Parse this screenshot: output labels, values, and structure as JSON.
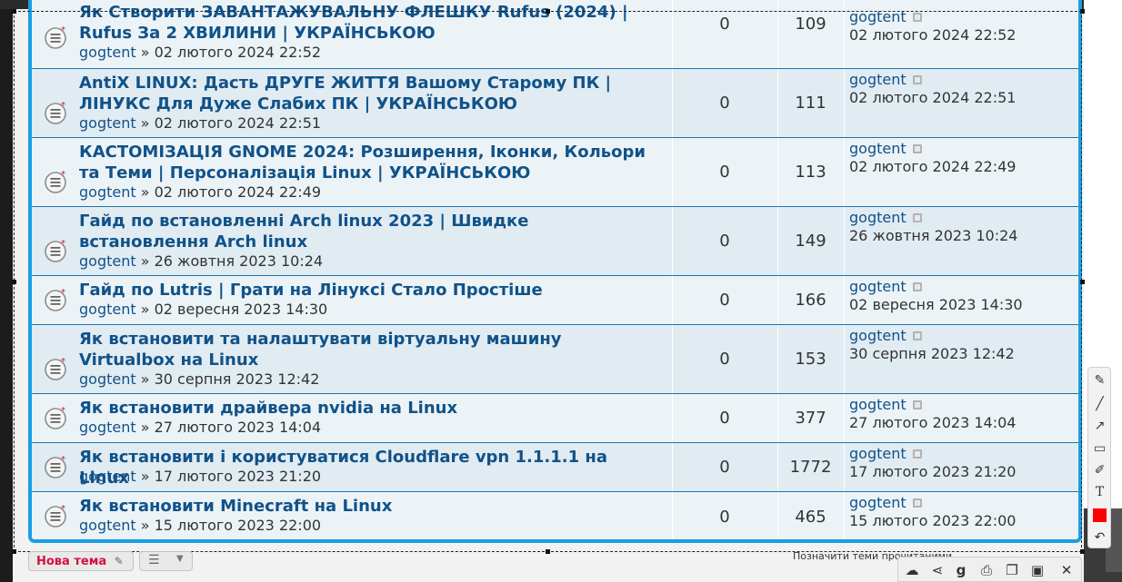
{
  "topics": [
    {
      "title": "Як Створити ЗАВАНТАЖУВАЛЬНУ ФЛЕШКУ Rufus (2024) | Rufus За 2 ХВИЛИНИ | УКРАЇНСЬКОЮ",
      "author": "gogtent",
      "sep": " » ",
      "date": "02 лютого 2024 22:52",
      "replies": "0",
      "views": "109",
      "last_author": "gogtent",
      "last_date": "02 лютого 2024 22:52"
    },
    {
      "title": "AntiX LINUX: Дасть ДРУГЕ ЖИТТЯ Вашому Старому ПК | ЛІНУКС Для Дуже Слабих ПК | УКРАЇНСЬКОЮ",
      "author": "gogtent",
      "sep": " » ",
      "date": "02 лютого 2024 22:51",
      "replies": "0",
      "views": "111",
      "last_author": "gogtent",
      "last_date": "02 лютого 2024 22:51"
    },
    {
      "title": "КАСТОМІЗАЦІЯ GNOME 2024: Розширення, Іконки, Кольори та Теми | Персоналізація Linux | УКРАЇНСЬКОЮ",
      "author": "gogtent",
      "sep": " » ",
      "date": "02 лютого 2024 22:49",
      "replies": "0",
      "views": "113",
      "last_author": "gogtent",
      "last_date": "02 лютого 2024 22:49"
    },
    {
      "title": "Гайд по встановленні Arch linux 2023 | Швидке встановлення Arch linux",
      "author": "gogtent",
      "sep": " » ",
      "date": "26 жовтня 2023 10:24",
      "replies": "0",
      "views": "149",
      "last_author": "gogtent",
      "last_date": "26 жовтня 2023 10:24"
    },
    {
      "title": "Гайд по Lutris | Грати на Лінуксі Стало Простіше",
      "author": "gogtent",
      "sep": " » ",
      "date": "02 вересня 2023 14:30",
      "replies": "0",
      "views": "166",
      "last_author": "gogtent",
      "last_date": "02 вересня 2023 14:30"
    },
    {
      "title": "Як встановити та налаштувати віртуальну машину Virtualbox на Linux",
      "author": "gogtent",
      "sep": " » ",
      "date": "30 серпня 2023 12:42",
      "replies": "0",
      "views": "153",
      "last_author": "gogtent",
      "last_date": "30 серпня 2023 12:42"
    },
    {
      "title": "Як встановити драйвера nvidia на Linux",
      "author": "gogtent",
      "sep": " » ",
      "date": "27 лютого 2023 14:04",
      "replies": "0",
      "views": "377",
      "last_author": "gogtent",
      "last_date": "27 лютого 2023 14:04"
    },
    {
      "title": "Як встановити і користуватися Cloudflare vpn 1.1.1.1 на Linux",
      "author": "gogtent",
      "sep": " » ",
      "date": "17 лютого 2023 21:20",
      "replies": "0",
      "views": "1772",
      "last_author": "gogtent",
      "last_date": "17 лютого 2023 21:20"
    },
    {
      "title": "Як встановити Minecraft на Linux",
      "author": "gogtent",
      "sep": " » ",
      "date": "15 лютого 2023 22:00",
      "replies": "0",
      "views": "465",
      "last_author": "gogtent",
      "last_date": "15 лютого 2023 22:00"
    }
  ],
  "actions": {
    "new_topic": "Нова тема",
    "mark_read": "Позначити теми прочитаними"
  },
  "palette_tools": [
    "pencil-icon",
    "line-icon",
    "arrow-icon",
    "rectangle-icon",
    "marker-icon",
    "text-icon",
    "color-icon",
    "undo-icon"
  ],
  "toolbar_tools": [
    "upload-icon",
    "share-icon",
    "search-google-icon",
    "print-icon",
    "copy-icon",
    "save-icon",
    "close-icon"
  ],
  "colors": {
    "accent": "#1a9ee4",
    "link": "#105289",
    "selected_color": "#ff0000",
    "new_topic_text": "#d31141"
  }
}
